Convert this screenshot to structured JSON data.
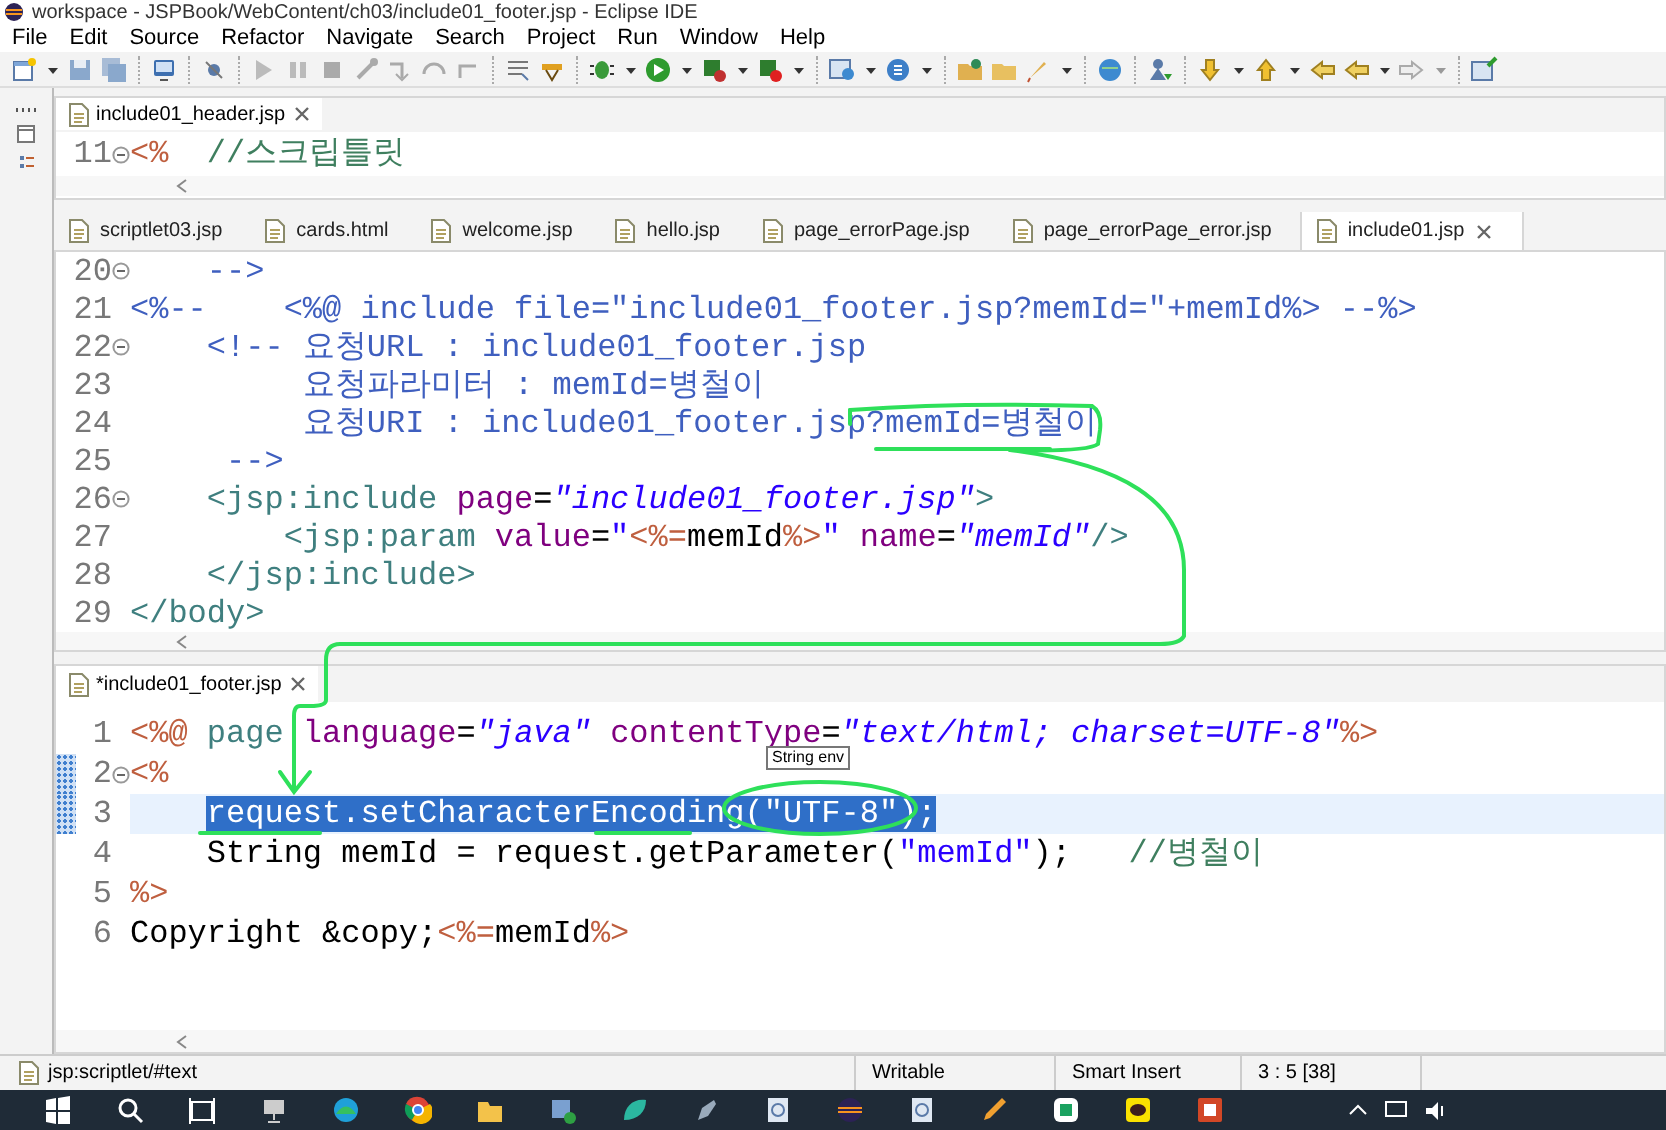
{
  "window": {
    "title": "workspace - JSPBook/WebContent/ch03/include01_footer.jsp - Eclipse IDE"
  },
  "menu": [
    "File",
    "Edit",
    "Source",
    "Refactor",
    "Navigate",
    "Search",
    "Project",
    "Run",
    "Window",
    "Help"
  ],
  "header_editor": {
    "tab": {
      "label": "include01_header.jsp"
    },
    "lines": [
      {
        "number": "11",
        "fold": true,
        "tokens": [
          {
            "kind": "jsp",
            "text": "<%"
          },
          {
            "kind": "java-comment",
            "text": "  //스크립틀릿"
          }
        ]
      }
    ]
  },
  "tabs": [
    {
      "label": "scriptlet03.jsp",
      "selected": false
    },
    {
      "label": "cards.html",
      "selected": false
    },
    {
      "label": "welcome.jsp",
      "selected": false
    },
    {
      "label": "hello.jsp",
      "selected": false
    },
    {
      "label": "page_errorPage.jsp",
      "selected": false
    },
    {
      "label": "page_errorPage_error.jsp",
      "selected": false
    },
    {
      "label": "include01.jsp",
      "selected": true
    }
  ],
  "main_editor": {
    "lines": [
      {
        "number": "20",
        "fold": true,
        "tokens": [
          {
            "kind": "comment",
            "text": "    -->"
          }
        ]
      },
      {
        "number": "21",
        "fold": false,
        "tokens": [
          {
            "kind": "jsp-comment",
            "text": "<%--    <%@ include file=\"include01_footer.jsp?memId=\"+memId%> --%>"
          }
        ]
      },
      {
        "number": "22",
        "fold": true,
        "tokens": [
          {
            "kind": "comment",
            "text": "    <!-- 요청URL : include01_footer.jsp"
          }
        ]
      },
      {
        "number": "23",
        "fold": false,
        "tokens": [
          {
            "kind": "comment",
            "text": "         요청파라미터 : memId=병철이"
          }
        ]
      },
      {
        "number": "24",
        "fold": false,
        "tokens": [
          {
            "kind": "comment",
            "text": "         요청URI : include01_footer.jsp?memId=병철이"
          }
        ]
      },
      {
        "number": "25",
        "fold": false,
        "tokens": [
          {
            "kind": "comment",
            "text": "     -->"
          }
        ]
      },
      {
        "number": "26",
        "fold": true,
        "tokens": [
          {
            "kind": "tag",
            "text": "    <jsp:include"
          },
          {
            "kind": "attr",
            "text": " page"
          },
          {
            "kind": "plain",
            "text": "="
          },
          {
            "kind": "value",
            "text": "\"include01_footer.jsp\""
          },
          {
            "kind": "tag",
            "text": ">"
          }
        ]
      },
      {
        "number": "27",
        "fold": false,
        "tokens": [
          {
            "kind": "tag",
            "text": "        <jsp:param"
          },
          {
            "kind": "attr",
            "text": " value"
          },
          {
            "kind": "plain",
            "text": "="
          },
          {
            "kind": "string",
            "text": "\""
          },
          {
            "kind": "jsp",
            "text": "<%="
          },
          {
            "kind": "plain",
            "text": "memId"
          },
          {
            "kind": "jsp",
            "text": "%>"
          },
          {
            "kind": "string",
            "text": "\""
          },
          {
            "kind": "attr",
            "text": " name"
          },
          {
            "kind": "plain",
            "text": "="
          },
          {
            "kind": "value",
            "text": "\"memId\""
          },
          {
            "kind": "tag",
            "text": "/>"
          }
        ]
      },
      {
        "number": "28",
        "fold": false,
        "tokens": [
          {
            "kind": "tag",
            "text": "    </jsp:include>"
          }
        ]
      },
      {
        "number": "29",
        "fold": false,
        "tokens": [
          {
            "kind": "tag",
            "text": "</body>"
          }
        ]
      }
    ]
  },
  "footer_editor": {
    "tab": {
      "label": "*include01_footer.jsp"
    },
    "tooltip": {
      "text": "String env"
    },
    "lines": [
      {
        "number": "1",
        "fold": false,
        "changed": false,
        "current": false,
        "tokens": [
          {
            "kind": "jsp",
            "text": "<%@"
          },
          {
            "kind": "tag",
            "text": " page"
          },
          {
            "kind": "attr",
            "text": " language"
          },
          {
            "kind": "plain",
            "text": "="
          },
          {
            "kind": "value",
            "text": "\"java\""
          },
          {
            "kind": "attr",
            "text": " contentType"
          },
          {
            "kind": "plain",
            "text": "="
          },
          {
            "kind": "value",
            "text": "\"text/html; charset=UTF-8\""
          },
          {
            "kind": "jsp",
            "text": "%>"
          }
        ]
      },
      {
        "number": "2",
        "fold": true,
        "changed": true,
        "current": false,
        "tokens": [
          {
            "kind": "jsp",
            "text": "<%"
          }
        ]
      },
      {
        "number": "3",
        "fold": false,
        "changed": true,
        "current": true,
        "indented": true,
        "tokens": [
          {
            "kind": "selection",
            "text": "request.setCharacterEncoding(\"UTF-8\");"
          }
        ]
      },
      {
        "number": "4",
        "fold": false,
        "changed": false,
        "current": false,
        "tokens": [
          {
            "kind": "plain",
            "text": "    String memId = request.getParameter("
          },
          {
            "kind": "string",
            "text": "\"memId\""
          },
          {
            "kind": "plain",
            "text": ");   "
          },
          {
            "kind": "java-comment",
            "text": "//병철이"
          }
        ]
      },
      {
        "number": "5",
        "fold": false,
        "changed": false,
        "current": false,
        "tokens": [
          {
            "kind": "jsp",
            "text": "%>"
          }
        ]
      },
      {
        "number": "6",
        "fold": false,
        "changed": false,
        "current": false,
        "tokens": [
          {
            "kind": "plain",
            "text": "Copyright &copy;"
          },
          {
            "kind": "jsp",
            "text": "<%="
          },
          {
            "kind": "plain",
            "text": "memId"
          },
          {
            "kind": "jsp",
            "text": "%>"
          }
        ]
      }
    ]
  },
  "status_bar": {
    "path": "jsp:scriptlet/#text",
    "mode": "Writable",
    "insert_mode": "Smart Insert",
    "position": "3 : 5 [38]"
  }
}
